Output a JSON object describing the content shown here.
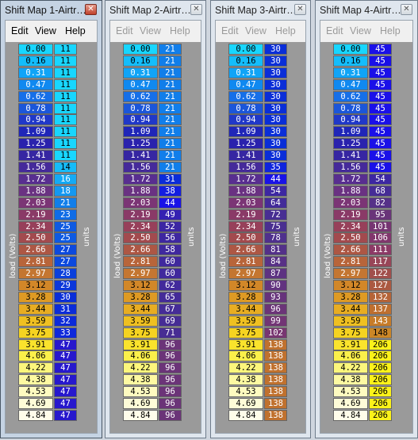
{
  "menu": [
    "Edit",
    "View",
    "Help"
  ],
  "close_glyph": "✕",
  "axis_labels": {
    "load": "load (Volts)",
    "units": "units"
  },
  "load_values": [
    "0.00",
    "0.16",
    "0.31",
    "0.47",
    "0.62",
    "0.78",
    "0.94",
    "1.09",
    "1.25",
    "1.41",
    "1.56",
    "1.72",
    "1.88",
    "2.03",
    "2.19",
    "2.34",
    "2.50",
    "2.66",
    "2.81",
    "2.97",
    "3.12",
    "3.28",
    "3.44",
    "3.59",
    "3.75",
    "3.91",
    "4.06",
    "4.22",
    "4.38",
    "4.53",
    "4.69",
    "4.84"
  ],
  "windows": [
    {
      "title": "Shift Map 1-Airtr…",
      "active": true,
      "units": [
        11,
        11,
        11,
        11,
        11,
        11,
        11,
        11,
        11,
        11,
        14,
        16,
        18,
        21,
        23,
        25,
        25,
        27,
        27,
        28,
        29,
        30,
        31,
        32,
        33,
        47,
        47,
        47,
        47,
        47,
        47,
        47
      ]
    },
    {
      "title": "Shift Map 2-Airtr…",
      "active": false,
      "units": [
        21,
        21,
        21,
        21,
        21,
        21,
        21,
        21,
        21,
        21,
        21,
        31,
        38,
        44,
        49,
        52,
        56,
        58,
        60,
        60,
        62,
        65,
        67,
        69,
        71,
        96,
        96,
        96,
        96,
        96,
        96,
        96
      ]
    },
    {
      "title": "Shift Map 3-Airtr…",
      "active": false,
      "units": [
        30,
        30,
        30,
        30,
        30,
        30,
        30,
        30,
        30,
        30,
        35,
        44,
        54,
        64,
        72,
        75,
        78,
        81,
        84,
        87,
        90,
        93,
        96,
        99,
        102,
        138,
        138,
        138,
        138,
        138,
        138,
        138
      ]
    },
    {
      "title": "Shift Map 4-Airtr…",
      "active": false,
      "units": [
        45,
        45,
        45,
        45,
        45,
        45,
        45,
        45,
        45,
        45,
        45,
        54,
        68,
        82,
        95,
        101,
        106,
        111,
        117,
        122,
        127,
        132,
        137,
        143,
        148,
        206,
        206,
        206,
        206,
        206,
        206,
        206
      ]
    }
  ],
  "load_colors": [
    "#18d6ff",
    "#14bdfb",
    "#10a4f7",
    "#1089f0",
    "#166fe8",
    "#1b56d9",
    "#2038c8",
    "#2026b8",
    "#2a22ad",
    "#3626a2",
    "#452a9a",
    "#582e90",
    "#6a3282",
    "#7b3575",
    "#8a3a67",
    "#97405a",
    "#a24a4e",
    "#ad5744",
    "#b8653a",
    "#c47631",
    "#d28728",
    "#de9a24",
    "#e8ad22",
    "#efc021",
    "#f5d321",
    "#fae32c",
    "#fbf04a",
    "#fcf67c",
    "#fdf9a2",
    "#fefbc0",
    "#fefcd8",
    "#fffdea"
  ],
  "unit_color_stops": [
    [
      11,
      "#18d6ff"
    ],
    [
      30,
      "#0a2ed8"
    ],
    [
      45,
      "#1a10e8"
    ],
    [
      50,
      "#3a25a5"
    ],
    [
      75,
      "#4a2f90"
    ],
    [
      96,
      "#6b3478"
    ],
    [
      110,
      "#8a3868"
    ],
    [
      125,
      "#a75545"
    ],
    [
      140,
      "#c4752a"
    ],
    [
      175,
      "#e6c41e"
    ],
    [
      206,
      "#fbf21a"
    ]
  ]
}
